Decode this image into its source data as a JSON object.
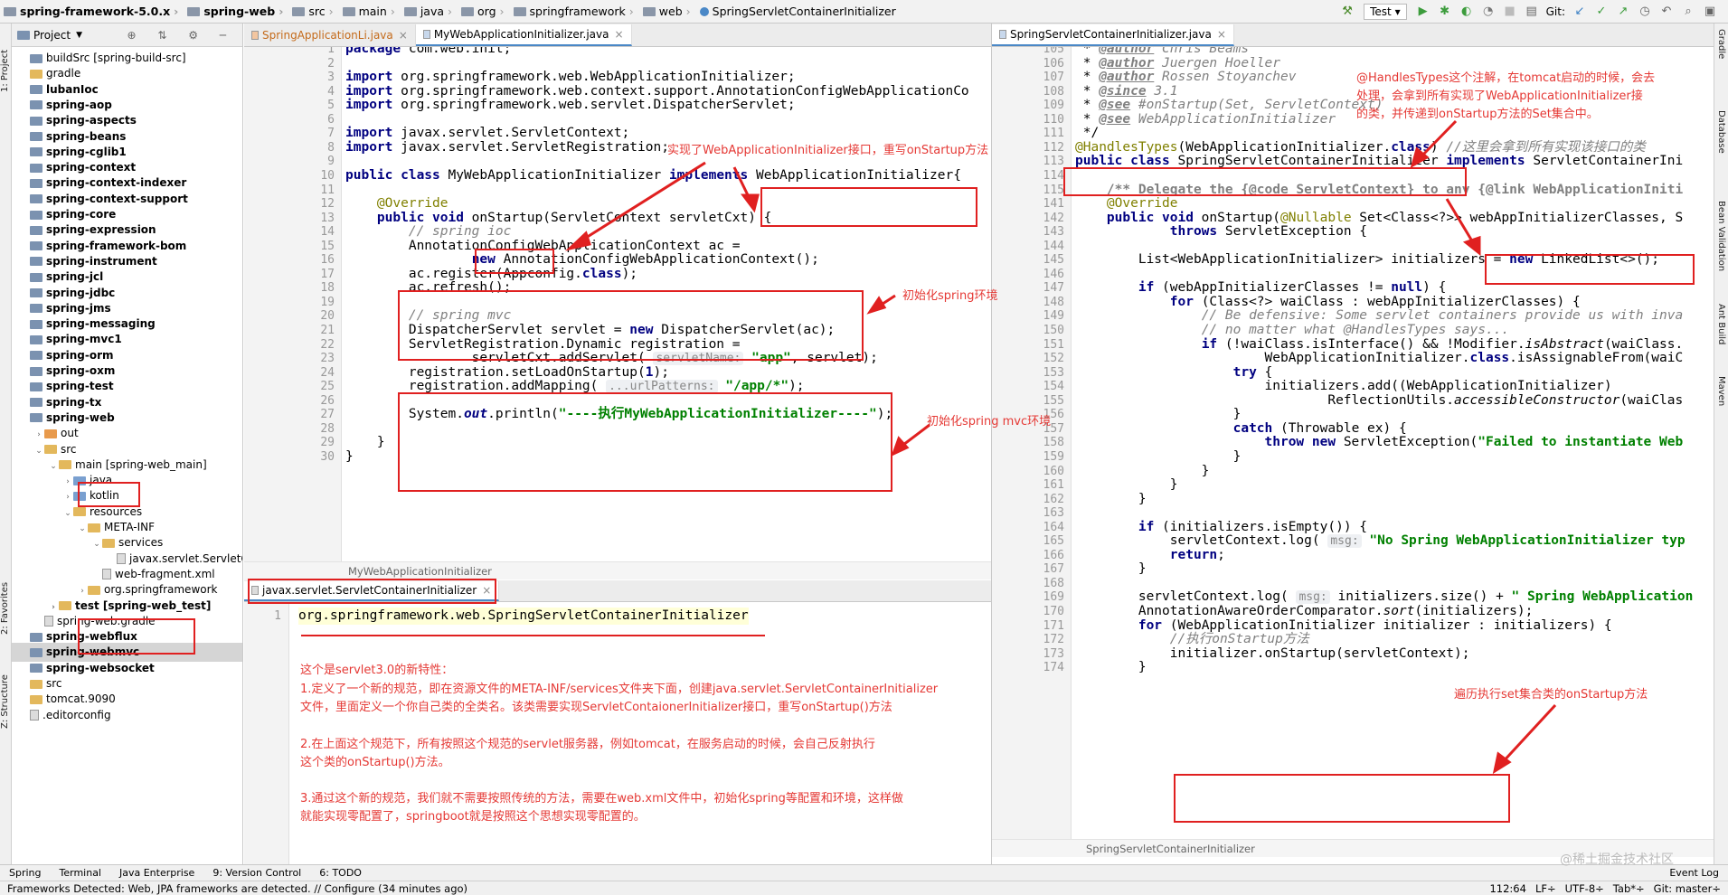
{
  "breadcrumbs": [
    "spring-framework-5.0.x",
    "spring-web",
    "src",
    "main",
    "java",
    "org",
    "springframework",
    "web",
    "SpringServletContainerInitializer"
  ],
  "toolbar": {
    "run_config": "Test",
    "git_label": "Git:"
  },
  "left_strip": {
    "project": "1: Project",
    "structure": "Z: Structure",
    "favorites": "2: Favorites"
  },
  "right_strip": [
    "Gradle",
    "Database",
    "Bean Validation",
    "Ant Build",
    "Maven"
  ],
  "project_panel": {
    "title": "Project",
    "items": [
      {
        "label": "buildSrc [spring-build-src]",
        "indent": 0,
        "icon": "mod",
        "bold": false,
        "arrow": ""
      },
      {
        "label": "gradle",
        "indent": 0,
        "icon": "fld",
        "bold": false,
        "arrow": ""
      },
      {
        "label": "lubanIoc",
        "indent": 0,
        "icon": "mod",
        "bold": true,
        "arrow": ""
      },
      {
        "label": "spring-aop",
        "indent": 0,
        "icon": "mod",
        "bold": true,
        "arrow": ""
      },
      {
        "label": "spring-aspects",
        "indent": 0,
        "icon": "mod",
        "bold": true,
        "arrow": ""
      },
      {
        "label": "spring-beans",
        "indent": 0,
        "icon": "mod",
        "bold": true,
        "arrow": ""
      },
      {
        "label": "spring-cglib1",
        "indent": 0,
        "icon": "mod",
        "bold": true,
        "arrow": ""
      },
      {
        "label": "spring-context",
        "indent": 0,
        "icon": "mod",
        "bold": true,
        "arrow": ""
      },
      {
        "label": "spring-context-indexer",
        "indent": 0,
        "icon": "mod",
        "bold": true,
        "arrow": ""
      },
      {
        "label": "spring-context-support",
        "indent": 0,
        "icon": "mod",
        "bold": true,
        "arrow": ""
      },
      {
        "label": "spring-core",
        "indent": 0,
        "icon": "mod",
        "bold": true,
        "arrow": ""
      },
      {
        "label": "spring-expression",
        "indent": 0,
        "icon": "mod",
        "bold": true,
        "arrow": ""
      },
      {
        "label": "spring-framework-bom",
        "indent": 0,
        "icon": "mod",
        "bold": true,
        "arrow": ""
      },
      {
        "label": "spring-instrument",
        "indent": 0,
        "icon": "mod",
        "bold": true,
        "arrow": ""
      },
      {
        "label": "spring-jcl",
        "indent": 0,
        "icon": "mod",
        "bold": true,
        "arrow": ""
      },
      {
        "label": "spring-jdbc",
        "indent": 0,
        "icon": "mod",
        "bold": true,
        "arrow": ""
      },
      {
        "label": "spring-jms",
        "indent": 0,
        "icon": "mod",
        "bold": true,
        "arrow": ""
      },
      {
        "label": "spring-messaging",
        "indent": 0,
        "icon": "mod",
        "bold": true,
        "arrow": ""
      },
      {
        "label": "spring-mvc1",
        "indent": 0,
        "icon": "mod",
        "bold": true,
        "arrow": ""
      },
      {
        "label": "spring-orm",
        "indent": 0,
        "icon": "mod",
        "bold": true,
        "arrow": ""
      },
      {
        "label": "spring-oxm",
        "indent": 0,
        "icon": "mod",
        "bold": true,
        "arrow": ""
      },
      {
        "label": "spring-test",
        "indent": 0,
        "icon": "mod",
        "bold": true,
        "arrow": ""
      },
      {
        "label": "spring-tx",
        "indent": 0,
        "icon": "mod",
        "bold": true,
        "arrow": ""
      },
      {
        "label": "spring-web",
        "indent": 0,
        "icon": "mod",
        "bold": true,
        "arrow": ""
      },
      {
        "label": "out",
        "indent": 1,
        "icon": "fldo",
        "bold": false,
        "arrow": "›"
      },
      {
        "label": "src",
        "indent": 1,
        "icon": "fld",
        "bold": false,
        "arrow": "⌄"
      },
      {
        "label": "main [spring-web_main]",
        "indent": 2,
        "icon": "fld",
        "bold": false,
        "arrow": "⌄"
      },
      {
        "label": "java",
        "indent": 3,
        "icon": "fldb",
        "bold": false,
        "arrow": "›"
      },
      {
        "label": "kotlin",
        "indent": 3,
        "icon": "fldb",
        "bold": false,
        "arrow": "›"
      },
      {
        "label": "resources",
        "indent": 3,
        "icon": "fld",
        "bold": false,
        "arrow": "⌄"
      },
      {
        "label": "META-INF",
        "indent": 4,
        "icon": "fld",
        "bold": false,
        "arrow": "⌄"
      },
      {
        "label": "services",
        "indent": 5,
        "icon": "fld",
        "bold": false,
        "arrow": "⌄"
      },
      {
        "label": "javax.servlet.ServletContainerInitializer",
        "indent": 6,
        "icon": "file",
        "bold": false,
        "arrow": ""
      },
      {
        "label": "web-fragment.xml",
        "indent": 5,
        "icon": "file",
        "bold": false,
        "arrow": ""
      },
      {
        "label": "org.springframework",
        "indent": 4,
        "icon": "fld",
        "bold": false,
        "arrow": "›"
      },
      {
        "label": "test [spring-web_test]",
        "indent": 2,
        "icon": "fld",
        "bold": true,
        "arrow": "›"
      },
      {
        "label": "spring-web.gradle",
        "indent": 1,
        "icon": "file",
        "bold": false,
        "arrow": ""
      },
      {
        "label": "spring-webflux",
        "indent": 0,
        "icon": "mod",
        "bold": true,
        "arrow": ""
      },
      {
        "label": "spring-webmvc",
        "indent": 0,
        "icon": "mod",
        "bold": true,
        "arrow": ""
      },
      {
        "label": "spring-websocket",
        "indent": 0,
        "icon": "mod",
        "bold": true,
        "arrow": ""
      },
      {
        "label": "src",
        "indent": 0,
        "icon": "fld",
        "bold": false,
        "arrow": ""
      },
      {
        "label": "tomcat.9090",
        "indent": 0,
        "icon": "fld",
        "bold": false,
        "arrow": ""
      },
      {
        "label": ".editorconfig",
        "indent": 0,
        "icon": "file",
        "bold": false,
        "arrow": ""
      }
    ],
    "selected_index": 38
  },
  "left_editor": {
    "tabs": [
      "SpringApplicationLi.java",
      "MyWebApplicationInitializer.java"
    ],
    "active_tab": 1,
    "footer": "MyWebApplicationInitializer",
    "lines": [
      {
        "n": "1",
        "html": "<span class=\"kw\">package</span> com.web.init;"
      },
      {
        "n": "2",
        "html": ""
      },
      {
        "n": "3",
        "html": "<span class=\"kw\">import</span> org.springframework.web.WebApplicationInitializer;"
      },
      {
        "n": "4",
        "html": "<span class=\"kw\">import</span> org.springframework.web.context.support.AnnotationConfigWebApplicationCo"
      },
      {
        "n": "5",
        "html": "<span class=\"kw\">import</span> org.springframework.web.servlet.DispatcherServlet;"
      },
      {
        "n": "6",
        "html": ""
      },
      {
        "n": "7",
        "html": "<span class=\"kw\">import</span> javax.servlet.ServletContext;"
      },
      {
        "n": "8",
        "html": "<span class=\"kw\">import</span> javax.servlet.ServletRegistration;"
      },
      {
        "n": "9",
        "html": ""
      },
      {
        "n": "10",
        "html": "<span class=\"kw\">public class</span> MyWebApplicationInitializer <span class=\"kw\">implements</span> WebApplicationInitializer{"
      },
      {
        "n": "11",
        "html": ""
      },
      {
        "n": "12",
        "html": "    <span class=\"an\">@Override</span>"
      },
      {
        "n": "13",
        "html": "    <span class=\"kw\">public void</span> onStartup(ServletContext servletCxt) {"
      },
      {
        "n": "14",
        "html": "        <span class=\"cm\">// spring ioc</span>"
      },
      {
        "n": "15",
        "html": "        AnnotationConfigWebApplicationContext ac ="
      },
      {
        "n": "16",
        "html": "                <span class=\"kw\">new</span> AnnotationConfigWebApplicationContext();"
      },
      {
        "n": "17",
        "html": "        ac.register(Appconfig.<span class=\"kw\">class</span>);"
      },
      {
        "n": "18",
        "html": "        ac.refresh();"
      },
      {
        "n": "19",
        "html": ""
      },
      {
        "n": "20",
        "html": "        <span class=\"cm\">// spring mvc</span>"
      },
      {
        "n": "21",
        "html": "        DispatcherServlet servlet = <span class=\"kw\">new</span> DispatcherServlet(ac);"
      },
      {
        "n": "22",
        "html": "        ServletRegistration.Dynamic registration ="
      },
      {
        "n": "23",
        "html": "                servletCxt.addServlet( <span class=\"hint\">servletName:</span> <span class=\"st\">\"app\"</span>, servlet);"
      },
      {
        "n": "24",
        "html": "        registration.setLoadOnStartup(<span class=\"kw\">1</span>);"
      },
      {
        "n": "25",
        "html": "        registration.addMapping( <span class=\"hint\">...urlPatterns:</span> <span class=\"st\">\"/app/*\"</span>);"
      },
      {
        "n": "26",
        "html": ""
      },
      {
        "n": "27",
        "html": "        System.<span class=\"kw\" style=\"font-style:italic\">out</span>.println(<span class=\"st\">\"----执行MyWebApplicationInitializer----\"</span>);"
      },
      {
        "n": "28",
        "html": ""
      },
      {
        "n": "29",
        "html": "    }"
      },
      {
        "n": "30",
        "html": "}"
      }
    ]
  },
  "bottom_editor": {
    "tab": "javax.servlet.ServletContainerInitializer",
    "line_no": "1",
    "content": "org.springframework.web.SpringServletContainerInitializer"
  },
  "right_editor": {
    "tab": "SpringServletContainerInitializer.java",
    "footer": "SpringServletContainerInitializer",
    "lines": [
      {
        "n": "105",
        "html": " * <span class=\"tagd\">@author</span> <span class=\"cm\">Chris Beams</span>"
      },
      {
        "n": "106",
        "html": " * <span class=\"tagd\">@author</span> <span class=\"cm\">Juergen Hoeller</span>"
      },
      {
        "n": "107",
        "html": " * <span class=\"tagd\">@author</span> <span class=\"cm\">Rossen Stoyanchev</span>"
      },
      {
        "n": "108",
        "html": " * <span class=\"tagd\">@since</span> <span class=\"cm\">3.1</span>"
      },
      {
        "n": "109",
        "html": " * <span class=\"tagd\">@see</span> <span class=\"cm\">#onStartup(Set, ServletContext)</span>"
      },
      {
        "n": "110",
        "html": " * <span class=\"tagd\">@see</span> <span class=\"cm\">WebApplicationInitializer</span>"
      },
      {
        "n": "111",
        "html": " */"
      },
      {
        "n": "112",
        "html": "<span class=\"an\">@HandlesTypes</span>(WebApplicationInitializer.<span class=\"kw\">class</span>) <span class=\"cm\">//这里会拿到所有实现该接口的类</span>"
      },
      {
        "n": "113",
        "html": "<span class=\"kw\">public class</span> SpringServletContainerInitializer <span class=\"kw\">implements</span> ServletContainerIni"
      },
      {
        "n": "114",
        "html": ""
      },
      {
        "n": "115",
        "html": "    <span class=\"cm\" style=\"font-style:normal;font-weight:bold\">/** Delegate the {@code ServletContext} to any {@link WebApplicationIniti</span>"
      },
      {
        "n": "141",
        "html": "    <span class=\"an\">@Override</span>"
      },
      {
        "n": "142",
        "html": "    <span class=\"kw\">public void</span> onStartup(<span class=\"an\">@Nullable</span> Set&lt;Class&lt;?&gt;&gt; webAppInitializerClasses, S"
      },
      {
        "n": "143",
        "html": "            <span class=\"kw\">throws</span> ServletException {"
      },
      {
        "n": "144",
        "html": ""
      },
      {
        "n": "145",
        "html": "        List&lt;WebApplicationInitializer&gt; initializers = <span class=\"kw\">new</span> LinkedList&lt;&gt;();"
      },
      {
        "n": "146",
        "html": ""
      },
      {
        "n": "147",
        "html": "        <span class=\"kw\">if</span> (webAppInitializerClasses != <span class=\"kw\">null</span>) {"
      },
      {
        "n": "148",
        "html": "            <span class=\"kw\">for</span> (Class&lt;?&gt; waiClass : webAppInitializerClasses) {"
      },
      {
        "n": "149",
        "html": "                <span class=\"cm\">// Be defensive: Some servlet containers provide us with inva</span>"
      },
      {
        "n": "150",
        "html": "                <span class=\"cm\">// no matter what @HandlesTypes says...</span>"
      },
      {
        "n": "151",
        "html": "                <span class=\"kw\">if</span> (!waiClass.isInterface() &amp;&amp; !Modifier.<i>isAbstract</i>(waiClass."
      },
      {
        "n": "152",
        "html": "                        WebApplicationInitializer.<span class=\"kw\">class</span>.isAssignableFrom(waiC"
      },
      {
        "n": "153",
        "html": "                    <span class=\"kw\">try</span> {"
      },
      {
        "n": "154",
        "html": "                        initializers.add((WebApplicationInitializer)"
      },
      {
        "n": "155",
        "html": "                                ReflectionUtils.<i>accessibleConstructor</i>(waiClas"
      },
      {
        "n": "156",
        "html": "                    }"
      },
      {
        "n": "157",
        "html": "                    <span class=\"kw\">catch</span> (Throwable ex) {"
      },
      {
        "n": "158",
        "html": "                        <span class=\"kw\">throw new</span> ServletException(<span class=\"st\">\"Failed to instantiate Web</span>"
      },
      {
        "n": "159",
        "html": "                    }"
      },
      {
        "n": "160",
        "html": "                }"
      },
      {
        "n": "161",
        "html": "            }"
      },
      {
        "n": "162",
        "html": "        }"
      },
      {
        "n": "163",
        "html": ""
      },
      {
        "n": "164",
        "html": "        <span class=\"kw\">if</span> (initializers.isEmpty()) {"
      },
      {
        "n": "165",
        "html": "            servletContext.log( <span class=\"hint\">msg:</span> <span class=\"st\">\"No Spring WebApplicationInitializer typ</span>"
      },
      {
        "n": "166",
        "html": "            <span class=\"kw\">return</span>;"
      },
      {
        "n": "167",
        "html": "        }"
      },
      {
        "n": "168",
        "html": ""
      },
      {
        "n": "169",
        "html": "        servletContext.log( <span class=\"hint\">msg:</span> initializers.size() + <span class=\"st\">\" Spring WebApplication</span>"
      },
      {
        "n": "170",
        "html": "        AnnotationAwareOrderComparator.<i>sort</i>(initializers);"
      },
      {
        "n": "171",
        "html": "        <span class=\"kw\">for</span> (WebApplicationInitializer initializer : initializers) {"
      },
      {
        "n": "172",
        "html": "            <span class=\"cm\">//执行onStartup方法</span>"
      },
      {
        "n": "173",
        "html": "            initializer.onStartup(servletContext);"
      },
      {
        "n": "174",
        "html": "        }"
      }
    ]
  },
  "annotations": {
    "implement_note": "实现了WebApplicationInitializer接口，重写onStartup方法",
    "spring_env_note": "初始化spring环境",
    "mvc_env_note": "初始化spring mvc环境",
    "handles_types_note_1": "@HandlesTypes这个注解，在tomcat启动的时候，会去",
    "handles_types_note_2": "处理，会拿到所有实现了WebApplicationInitializer接",
    "handles_types_note_3": "的类，并传递到onStartup方法的Set集合中。",
    "loop_note": "遍历执行set集合类的onStartup方法",
    "spi_title": "这个是servlet3.0的新特性：",
    "spi_1a": "1.定义了一个新的规范，即在资源文件的META-INF/services文件夹下面，创建java.servlet.ServletContainerInitializer",
    "spi_1b": "文件，里面定义一个你自己类的全类名。该类需要实现ServletContaionerInitializer接口，重写onStartup()方法",
    "spi_2a": "2.在上面这个规范下，所有按照这个规范的servlet服务器，例如tomcat，在服务启动的时候，会自己反射执行",
    "spi_2b": "这个类的onStartup()方法。",
    "spi_3a": "3.通过这个新的规范，我们就不需要按照传统的方法，需要在web.xml文件中，初始化spring等配置和环境，这样做",
    "spi_3b": "就能实现零配置了，springboot就是按照这个思想实现零配置的。"
  },
  "bottom_tabs": [
    "Spring",
    "Terminal",
    "Java Enterprise",
    "9: Version Control",
    "6: TODO"
  ],
  "event_log": "Event Log",
  "status": {
    "message": "Frameworks Detected: Web, JPA frameworks are detected. // Configure (34 minutes ago)",
    "position": "112:64",
    "line_sep": "LF÷",
    "encoding": "UTF-8÷",
    "indent": "Tab*÷",
    "git_branch": "Git: master÷"
  },
  "watermark": "@稀土掘金技术社区"
}
